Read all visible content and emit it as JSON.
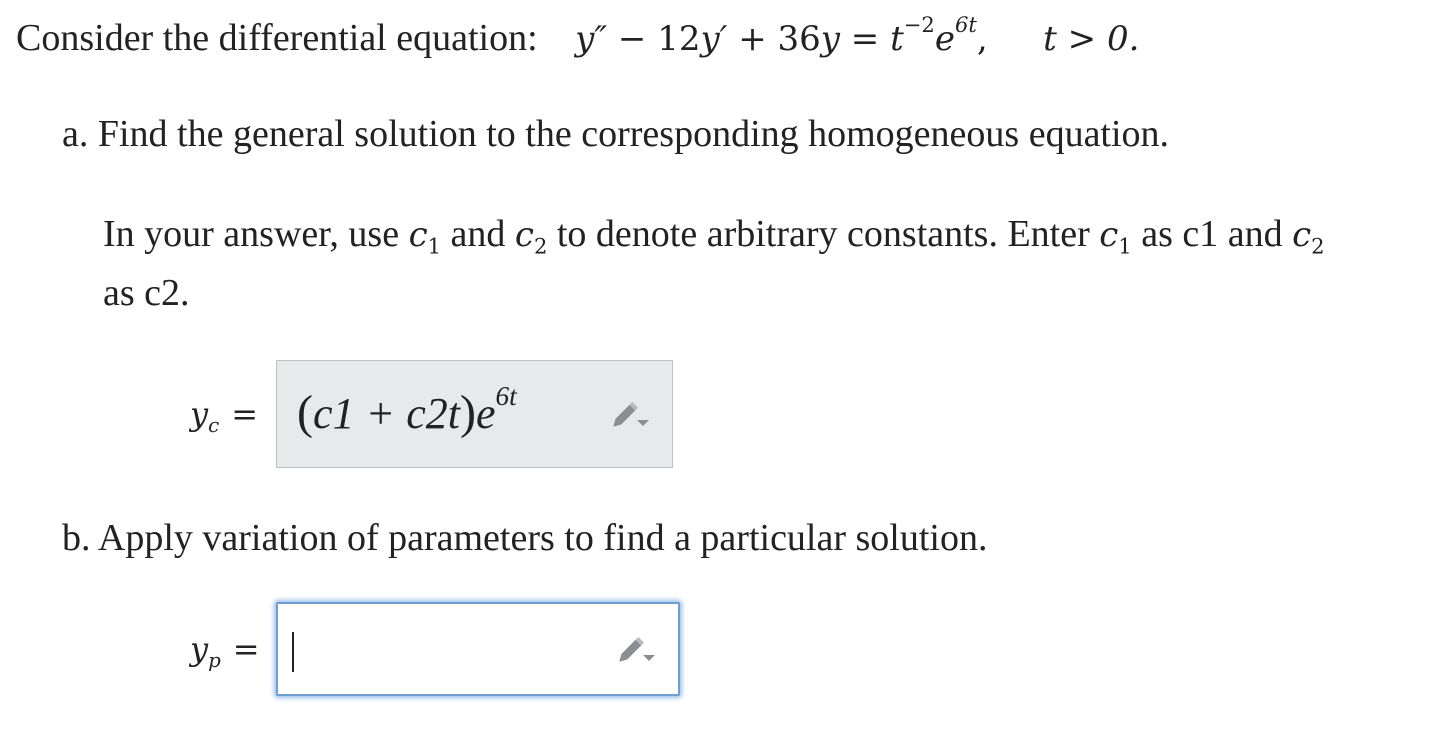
{
  "problem": {
    "intro_text": "Consider the differential equation:",
    "equation": {
      "y_double_prime": "y″",
      "minus": " − ",
      "coef_12": "12",
      "y_prime": "y′",
      "plus": " + ",
      "coef_36": "36",
      "y": "y",
      "equals": " = ",
      "t": "t",
      "t_exp": "−2",
      "e": "e",
      "e_exp": "6t",
      "comma": ","
    },
    "condition": "t > 0."
  },
  "part_a": {
    "prompt": "a. Find the general solution to the corresponding homogeneous equation.",
    "instruction_1": "In your answer, use ",
    "c1_sym": "c",
    "c1_sub": "1",
    "and_1": " and ",
    "c2_sym": "c",
    "c2_sub": "2",
    "instruction_2": " to denote arbitrary constants. Enter ",
    "c1b_sym": "c",
    "c1b_sub": "1",
    "as_c1": " as c1 and ",
    "c2b_sym": "c",
    "c2b_sub": "2",
    "as_c2": "as c2.",
    "answer_label_y": "y",
    "answer_label_sub": "c",
    "answer_equals": "=",
    "answer_value": {
      "open": "(",
      "body": "c1 + c2t",
      "close": ")",
      "e": "e",
      "exp": "6t"
    }
  },
  "part_b": {
    "prompt": "b. Apply variation of parameters to find a particular solution.",
    "answer_label_y": "y",
    "answer_label_sub": "p",
    "answer_equals": "=",
    "answer_value": ""
  },
  "icons": {
    "edit": "pencil-dropdown-icon"
  },
  "colors": {
    "readonly_box_bg": "#e8e9eb",
    "active_box_border": "#6f9fd1",
    "icon_gray": "#8a8d91"
  }
}
